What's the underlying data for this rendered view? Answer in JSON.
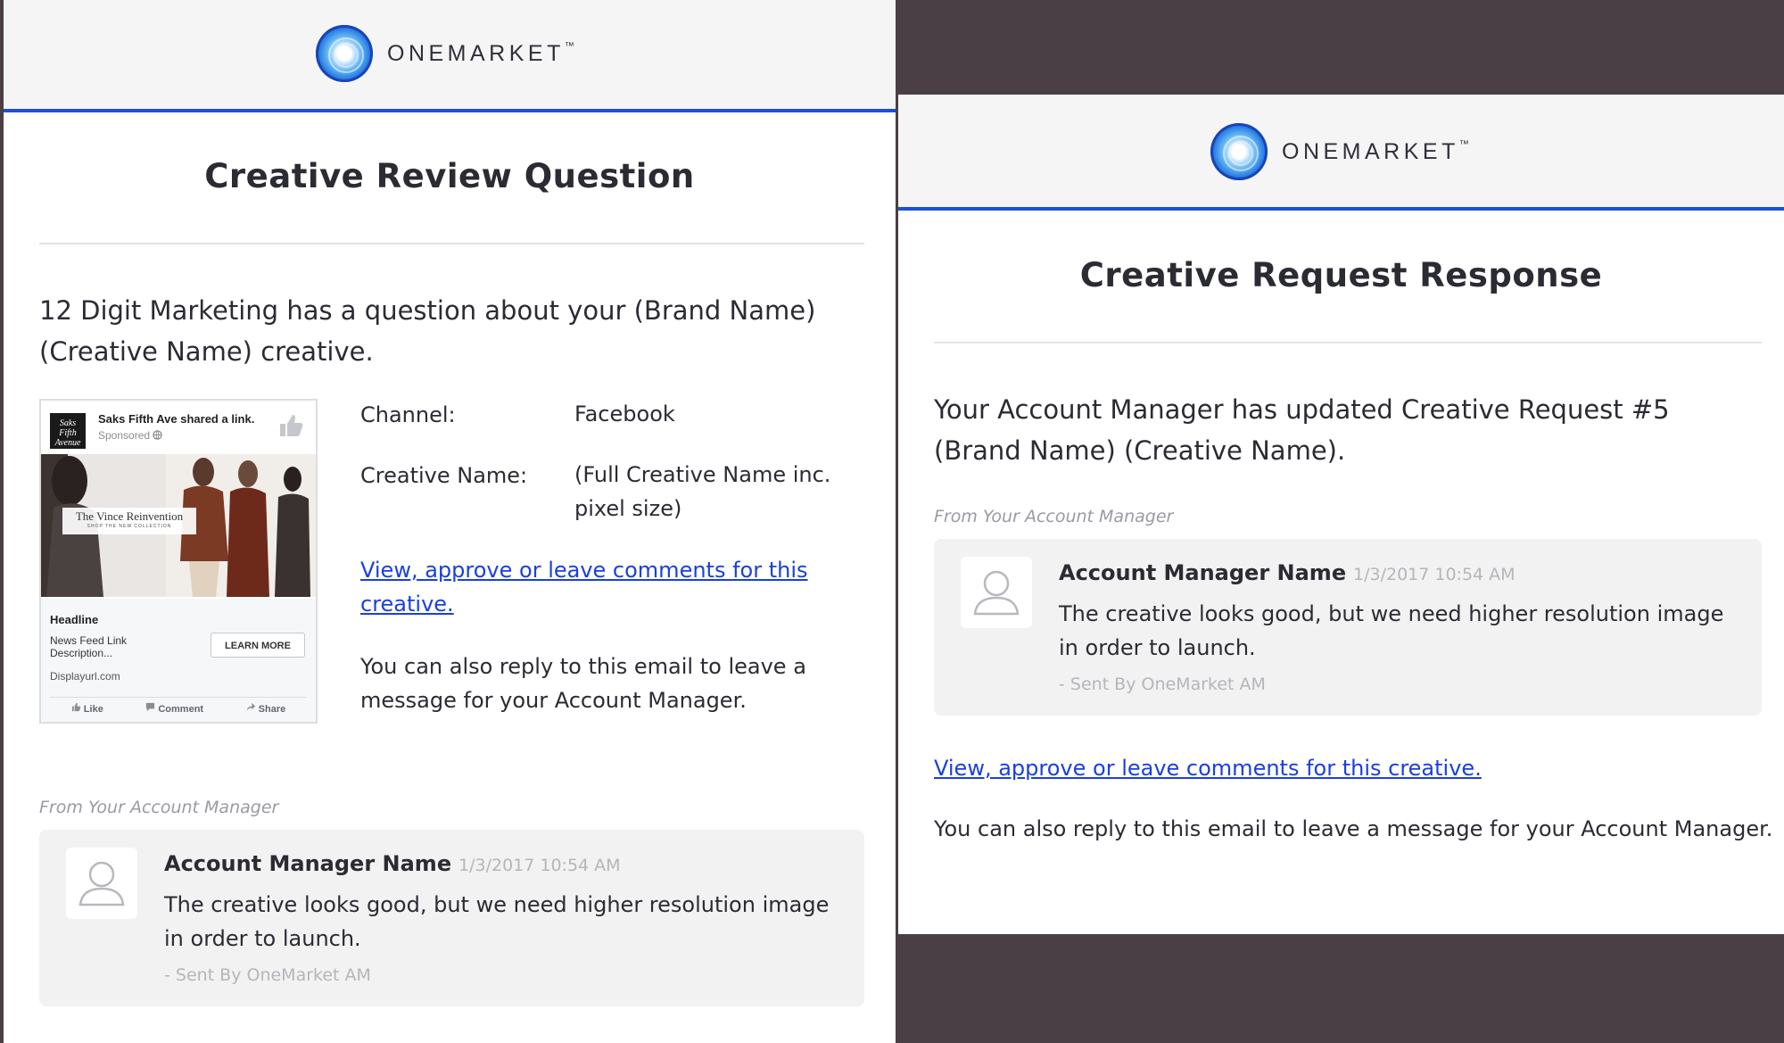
{
  "brand": {
    "logo_text": "ONEMARKET",
    "logo_tm": "™",
    "accent": "#1f4fd6",
    "link_color": "#1a3fe0"
  },
  "left_email": {
    "title": "Creative Review Question",
    "intro_line1": "12 Digit Marketing has a question about your (Brand Name)",
    "intro_line2": "(Creative Name) creative.",
    "channel_label": "Channel:",
    "channel_value": "Facebook",
    "creative_name_label": "Creative Name:",
    "creative_name_value_line1": "(Full Creative Name inc.",
    "creative_name_value_line2": "pixel size)",
    "link_line1": "View, approve or leave comments for this",
    "link_line2": "creative.",
    "reply_line1": "You can also reply to this email to leave a",
    "reply_line2": "message for your Account Manager.",
    "from_label": "From Your Account Manager",
    "comment": {
      "name": "Account Manager Name",
      "time": "1/3/2017 10:54 AM",
      "body_line1": "The creative looks good, but we need higher resolution image",
      "body_line2": "in order to launch.",
      "sent_by": "- Sent By OneMarket AM"
    }
  },
  "fb_ad": {
    "page_name": "Saks Fifth Ave shared a link.",
    "sponsored": "Sponsored",
    "avatar_text": "Saks Fifth Avenue",
    "overlay_title": "The Vince Reinvention",
    "overlay_sub": "SHOP THE NEW COLLECTION",
    "headline": "Headline",
    "description": "News Feed Link Description...",
    "url": "Displayurl.com",
    "cta": "LEARN MORE",
    "actions": {
      "like": "Like",
      "comment": "Comment",
      "share": "Share"
    }
  },
  "right_email": {
    "title": "Creative Request Response",
    "intro_line1": "Your Account Manager has updated Creative Request #5",
    "intro_line2": "(Brand Name) (Creative Name).",
    "from_label": "From Your Account Manager",
    "comment": {
      "name": "Account Manager Name",
      "time": "1/3/2017 10:54 AM",
      "body_line1": "The creative looks good, but we need higher resolution image",
      "body_line2": "in order to launch.",
      "sent_by": "- Sent By OneMarket AM"
    },
    "link": "View, approve or leave comments for this creative.",
    "reply": "You can also reply to this email to leave a message for your Account Manager."
  },
  "icons": [
    "onemarket-logo-icon",
    "user-avatar-icon",
    "thumbs-up-icon",
    "globe-icon",
    "like-icon",
    "comment-icon",
    "share-icon"
  ]
}
